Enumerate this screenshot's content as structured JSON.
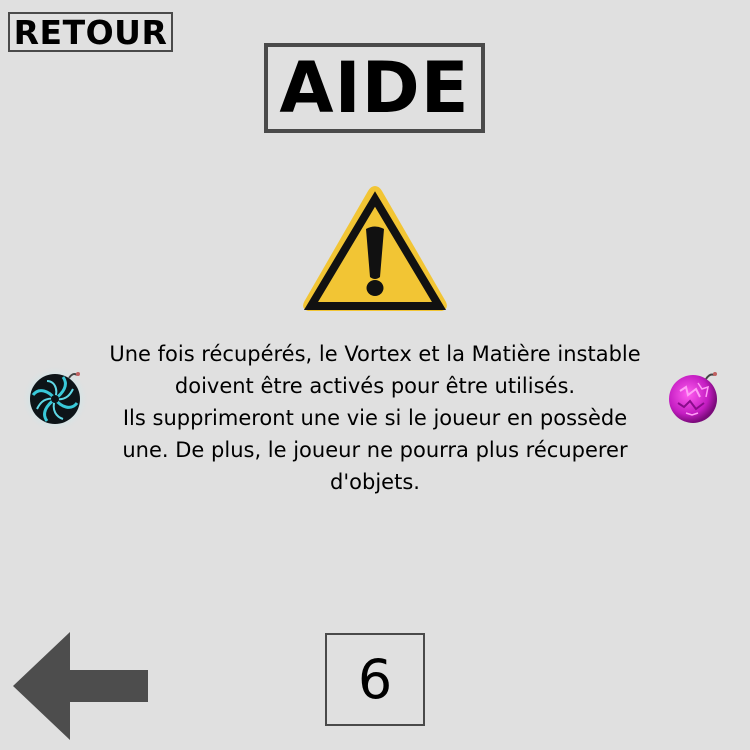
{
  "header": {
    "back_label": "RETOUR",
    "title": "AIDE"
  },
  "content": {
    "warning_icon": "warning-triangle-icon",
    "lines": [
      "Une fois récupérés, le Vortex et la Matière instable",
      "doivent être activés pour être utilisés.",
      "Ils supprimeront une vie si le joueur en possède",
      "une. De plus, le joueur ne pourra plus récuperer",
      "d'objets."
    ],
    "left_item_icon": "vortex-bomb-icon",
    "right_item_icon": "unstable-matter-bomb-icon"
  },
  "footer": {
    "prev_icon": "left-arrow-icon",
    "page_number": "6"
  },
  "colors": {
    "background": "#e0e0e0",
    "border": "#4a4a4a",
    "arrow": "#4d4d4d",
    "warning_yellow": "#f2c534",
    "vortex_cyan": "#39c9d9",
    "matter_magenta": "#d21fd0"
  }
}
